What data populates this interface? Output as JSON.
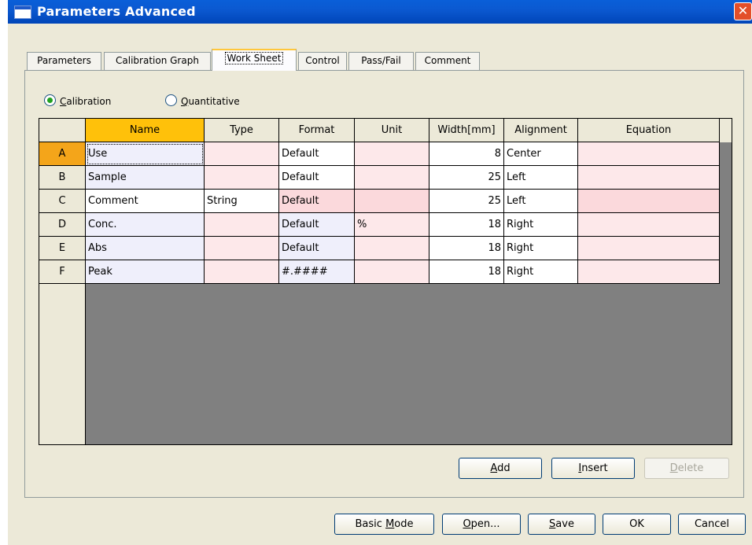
{
  "window": {
    "title": "Parameters  Advanced",
    "close_symbol": "✕"
  },
  "tabs": [
    {
      "label": "Parameters",
      "active": false
    },
    {
      "label": "Calibration Graph",
      "active": false
    },
    {
      "label": "Work Sheet",
      "active": true
    },
    {
      "label": "Control",
      "active": false
    },
    {
      "label": "Pass/Fail",
      "active": false
    },
    {
      "label": "Comment",
      "active": false
    }
  ],
  "mode": {
    "calibration": {
      "mnemonic": "C",
      "rest": "alibration",
      "selected": true
    },
    "quantitative": {
      "mnemonic": "Q",
      "rest": "uantitative",
      "selected": false
    }
  },
  "grid": {
    "columns": [
      "Name",
      "Type",
      "Format",
      "Unit",
      "Width[mm]",
      "Alignment",
      "Equation"
    ],
    "rows": [
      {
        "id": "A",
        "name": "Use",
        "type": "",
        "format": "Default",
        "unit": "",
        "width": "8",
        "alignment": "Center",
        "equation": ""
      },
      {
        "id": "B",
        "name": "Sample",
        "type": "",
        "format": "Default",
        "unit": "",
        "width": "25",
        "alignment": "Left",
        "equation": ""
      },
      {
        "id": "C",
        "name": "Comment",
        "type": "String",
        "format": "Default",
        "unit": "",
        "width": "25",
        "alignment": "Left",
        "equation": ""
      },
      {
        "id": "D",
        "name": "Conc.",
        "type": "",
        "format": "Default",
        "unit": "%",
        "width": "18",
        "alignment": "Right",
        "equation": ""
      },
      {
        "id": "E",
        "name": "Abs",
        "type": "",
        "format": "Default",
        "unit": "",
        "width": "18",
        "alignment": "Right",
        "equation": ""
      },
      {
        "id": "F",
        "name": "Peak",
        "type": "",
        "format": "#.####",
        "unit": "",
        "width": "18",
        "alignment": "Right",
        "equation": ""
      }
    ]
  },
  "grid_buttons": {
    "add": {
      "mnemonic": "A",
      "rest": "dd",
      "enabled": true
    },
    "insert": {
      "mnemonic": "I",
      "rest": "nsert",
      "enabled": true
    },
    "delete": {
      "mnemonic": "D",
      "rest": "elete",
      "enabled": false
    }
  },
  "footer_buttons": {
    "basic_mode": {
      "before": "Basic ",
      "mnemonic": "M",
      "rest": "ode"
    },
    "open": {
      "mnemonic": "O",
      "rest": "pen..."
    },
    "save": {
      "mnemonic": "S",
      "rest": "ave"
    },
    "ok": {
      "label": "OK"
    },
    "cancel": {
      "label": "Cancel"
    }
  },
  "icons": {
    "window": "window-icon",
    "close": "close-icon",
    "radio": "radio-icon"
  }
}
